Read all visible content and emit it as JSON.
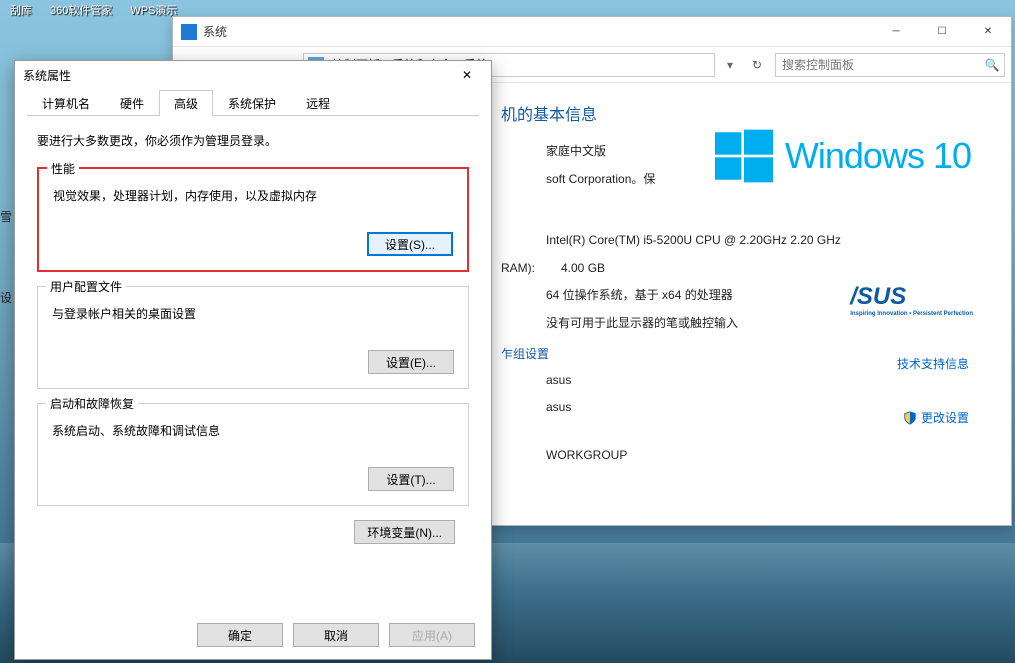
{
  "desktop": {
    "icons": [
      "刮库",
      "360软件管家",
      "WPS演示"
    ]
  },
  "systemWindow": {
    "title": "系统",
    "breadcrumb": [
      "控制面板",
      "系统和安全",
      "系统"
    ],
    "searchPlaceholder": "搜索控制面板",
    "heading": "机的基本信息",
    "edition1": "家庭中文版",
    "copyright": "soft Corporation。保",
    "win10Label": "Windows 10",
    "spec": {
      "cpu": "Intel(R) Core(TM) i5-5200U CPU @ 2.20GHz 2.20 GHz",
      "ramLabel": "RAM):",
      "ram": "4.00 GB",
      "sysType": "64 位操作系统，基于 x64 的处理器",
      "penTouch": "没有可用于此显示器的笔或触控输入"
    },
    "supportLink": "技术支持信息",
    "groupHeading": "乍组设置",
    "computer1": "asus",
    "computer2": "asus",
    "workgroup": "WORKGROUP",
    "changeLink": "更改设置",
    "asus": "/SUS",
    "asusSub": "Inspiring Innovation • Persistent Perfection"
  },
  "propsDialog": {
    "title": "系统属性",
    "tabs": [
      "计算机名",
      "硬件",
      "高级",
      "系统保护",
      "远程"
    ],
    "activeTab": 2,
    "note": "要进行大多数更改，你必须作为管理员登录。",
    "perf": {
      "legend": "性能",
      "desc": "视觉效果，处理器计划，内存使用，以及虚拟内存",
      "btn": "设置(S)..."
    },
    "userProfile": {
      "legend": "用户配置文件",
      "desc": "与登录帐户相关的桌面设置",
      "btn": "设置(E)..."
    },
    "startup": {
      "legend": "启动和故障恢复",
      "desc": "系统启动、系统故障和调试信息",
      "btn": "设置(T)..."
    },
    "envBtn": "环境变量(N)...",
    "ok": "确定",
    "cancel": "取消",
    "apply": "应用(A)"
  }
}
